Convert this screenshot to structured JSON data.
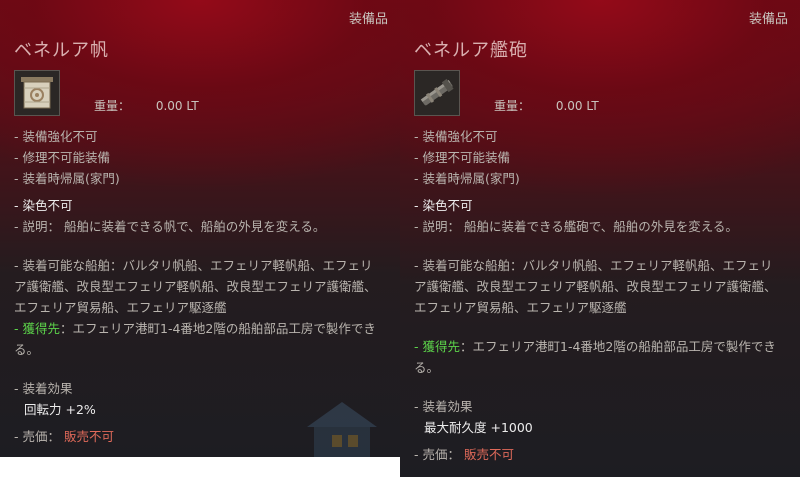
{
  "panels": [
    {
      "category": "装備品",
      "title": "ベネルア帆",
      "icon": "sail-icon",
      "weight_label": "重量：",
      "weight_value": "0.00 LT",
      "tags": [
        "- 装備強化不可",
        "- 修理不可能装備",
        "- 装着時帰属(家門)"
      ],
      "dye": "- 染色不可",
      "desc": "- 説明： 船舶に装着できる帆で、船舶の外見を変える。",
      "ships_label": "- 装着可能な船舶：",
      "ships_text": "バルタリ帆船、エフェリア軽帆船、エフェリア護衛艦、改良型エフェリア軽帆船、改良型エフェリア護衛艦、エフェリア貿易船、エフェリア駆逐艦",
      "acq_prefix": "- ",
      "acq_label": "獲得先",
      "acq_text": "：エフェリア港町1-4番地2階の船舶部品工房で製作できる。",
      "effect_label": "- 装着効果",
      "effect_value": "回転力 +2%",
      "price_label": "- 売価：",
      "price_value": "販売不可"
    },
    {
      "category": "装備品",
      "title": "ベネルア艦砲",
      "icon": "cannon-icon",
      "weight_label": "重量：",
      "weight_value": "0.00 LT",
      "tags": [
        "- 装備強化不可",
        "- 修理不可能装備",
        "- 装着時帰属(家門)"
      ],
      "dye": "- 染色不可",
      "desc": "- 説明： 船舶に装着できる艦砲で、船舶の外見を変える。",
      "ships_label": "- 装着可能な船舶：",
      "ships_text": "バルタリ帆船、エフェリア軽帆船、エフェリア護衛艦、改良型エフェリア軽帆船、改良型エフェリア護衛艦、エフェリア貿易船、エフェリア駆逐艦",
      "acq_prefix": "- ",
      "acq_label": "獲得先",
      "acq_text": "：エフェリア港町1-4番地2階の船舶部品工房で製作できる。",
      "effect_label": "- 装着効果",
      "effect_value": "最大耐久度 +1000",
      "price_label": "- 売価：",
      "price_value": "販売不可"
    }
  ]
}
